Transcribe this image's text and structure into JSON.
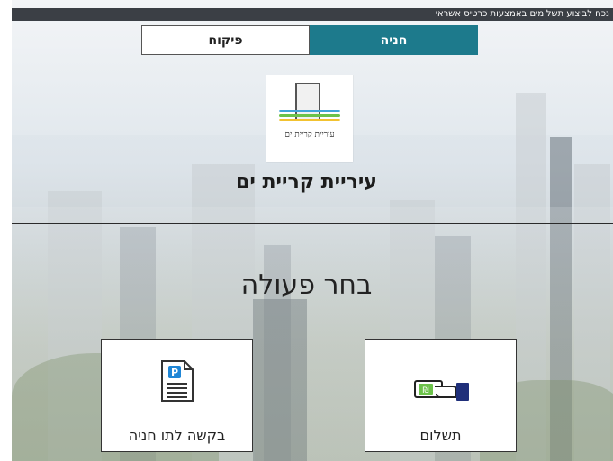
{
  "banner": {
    "text": "נכח לביצוע תשלומים באמצעות כרטיס אשראי"
  },
  "tabs": [
    {
      "label": "פיקוח",
      "active": false
    },
    {
      "label": "חניה",
      "active": true
    }
  ],
  "logo": {
    "text": "עיריית קריית ים"
  },
  "city": {
    "name": "עיריית קריית ים"
  },
  "main": {
    "prompt": "בחר פעולה"
  },
  "actions": [
    {
      "label": "בקשה לתו חניה",
      "icon": "parking-document-icon"
    },
    {
      "label": "תשלום",
      "icon": "payment-hand-icon"
    }
  ],
  "colors": {
    "accent": "#1d7a8c",
    "banner": "#3b3f45"
  }
}
